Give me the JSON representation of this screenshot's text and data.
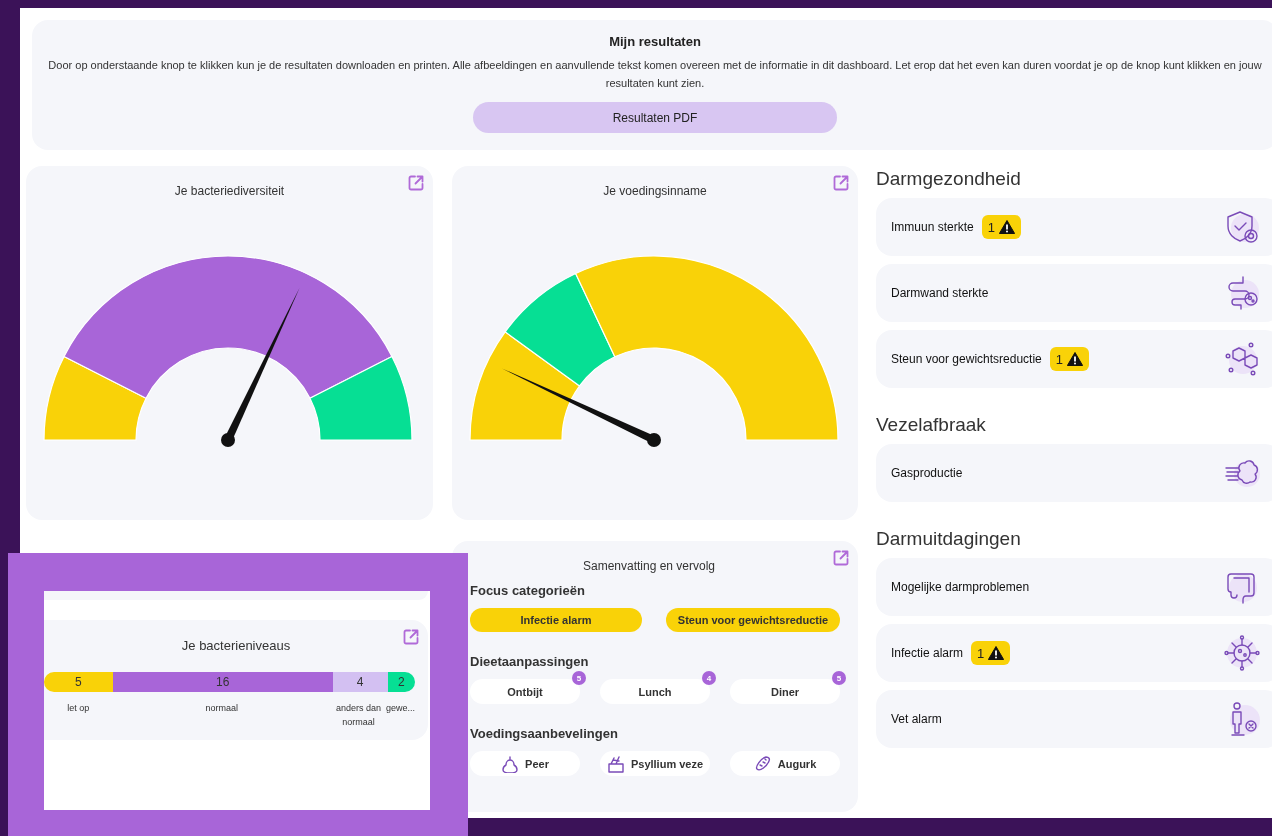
{
  "header": {
    "title": "Mijn resultaten",
    "text": "Door op onderstaande knop te klikken kun je de resultaten downloaden en printen. Alle afbeeldingen en aanvullende tekst komen overeen met de informatie in dit dashboard. Let erop dat het even kan duren voordat je op de knop kunt klikken en jouw resultaten kunt zien.",
    "button": "Resultaten PDF"
  },
  "gauges": [
    {
      "title": "Je bacteriediversiteit",
      "segments": [
        {
          "color": "#f9d208"
        },
        {
          "color": "#a865d8"
        },
        {
          "color": "#06df94"
        }
      ]
    },
    {
      "title": "Je voedingsinname",
      "segments": [
        {
          "color": "#f9d208"
        },
        {
          "color": "#06df94"
        },
        {
          "color": "#f9d208"
        }
      ]
    }
  ],
  "summary": {
    "title": "Samenvatting en vervolg",
    "focus_heading": "Focus categorieën",
    "focus": [
      "Infectie alarm",
      "Steun voor gewichtsreductie"
    ],
    "diet_heading": "Dieetaanpassingen",
    "diet": [
      {
        "label": "Ontbijt",
        "count": "5"
      },
      {
        "label": "Lunch",
        "count": "4"
      },
      {
        "label": "Diner",
        "count": "5"
      }
    ],
    "food_heading": "Voedingsaanbevelingen",
    "foods": [
      "Peer",
      "Psyllium veze",
      "Augurk"
    ]
  },
  "sections": [
    {
      "heading": "Darmgezondheid",
      "items": [
        {
          "label": "Immuun sterkte",
          "alerts": "1"
        },
        {
          "label": "Darmwand sterkte"
        },
        {
          "label": "Steun voor gewichtsreductie",
          "alerts": "1"
        }
      ]
    },
    {
      "heading": "Vezelafbraak",
      "items": [
        {
          "label": "Gasproductie"
        }
      ]
    },
    {
      "heading": "Darmuitdagingen",
      "items": [
        {
          "label": "Mogelijke darmproblemen"
        },
        {
          "label": "Infectie alarm",
          "alerts": "1"
        },
        {
          "label": "Vet alarm"
        }
      ]
    }
  ],
  "inset": {
    "title": "Je bacterieniveaus",
    "segments": [
      {
        "value": "5",
        "label": "let op",
        "color": "#f9d208"
      },
      {
        "value": "16",
        "label": "normaal",
        "color": "#a865d8"
      },
      {
        "value": "4",
        "label": "anders dan normaal",
        "color": "#d3c0f2"
      },
      {
        "value": "2",
        "label": "gewe...",
        "color": "#06df94"
      }
    ]
  }
}
